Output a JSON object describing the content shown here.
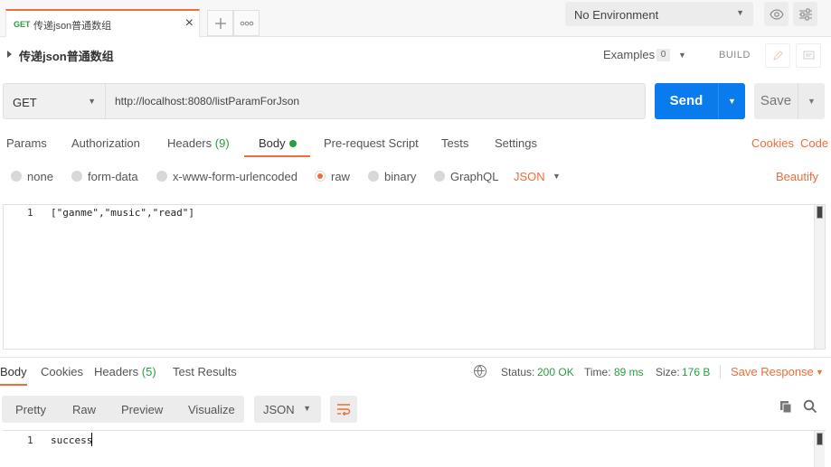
{
  "tabbar": {
    "tab_method": "GET",
    "tab_name": "传递json普通数组",
    "close_glyph": "✕",
    "new_tab_glyph": "+",
    "more_glyph": "ooo",
    "environment": "No Environment"
  },
  "request": {
    "title": "传递json普通数组",
    "examples_label": "Examples",
    "examples_count": "0",
    "build_label": "BUILD",
    "method": "GET",
    "url": "http://localhost:8080/listParamForJson",
    "send_label": "Send",
    "save_label": "Save"
  },
  "request_tabs": [
    {
      "label": "Params"
    },
    {
      "label": "Authorization"
    },
    {
      "label": "Headers",
      "count": "(9)"
    },
    {
      "label": "Body"
    },
    {
      "label": "Pre-request Script"
    },
    {
      "label": "Tests"
    },
    {
      "label": "Settings"
    }
  ],
  "request_links": {
    "cookies": "Cookies",
    "code": "Code"
  },
  "body_types": [
    {
      "label": "none"
    },
    {
      "label": "form-data"
    },
    {
      "label": "x-www-form-urlencoded"
    },
    {
      "label": "raw",
      "selected": true
    },
    {
      "label": "binary"
    },
    {
      "label": "GraphQL"
    }
  ],
  "body_format": "JSON",
  "beautify_label": "Beautify",
  "editor": {
    "line_number": "1",
    "code": "[\"ganme\",\"music\",\"read\"]"
  },
  "response": {
    "tabs": [
      {
        "label": "Body"
      },
      {
        "label": "Cookies"
      },
      {
        "label": "Headers",
        "count": "(5)"
      },
      {
        "label": "Test Results"
      }
    ],
    "status_label": "Status:",
    "status_value": "200 OK",
    "time_label": "Time:",
    "time_value": "89 ms",
    "size_label": "Size:",
    "size_value": "176 B",
    "save_response": "Save Response",
    "views": [
      "Pretty",
      "Raw",
      "Preview",
      "Visualize"
    ],
    "format": "JSON",
    "line_number": "1",
    "body": "success"
  },
  "colors": {
    "accent": "#f26b3a",
    "send": "#097bed",
    "success": "#2a9d3f"
  }
}
